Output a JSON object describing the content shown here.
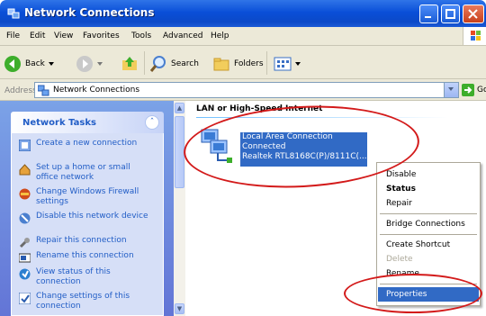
{
  "window": {
    "title": "Network Connections"
  },
  "menu": [
    "File",
    "Edit",
    "View",
    "Favorites",
    "Tools",
    "Advanced",
    "Help"
  ],
  "toolbar": {
    "back": "Back",
    "search": "Search",
    "folders": "Folders"
  },
  "address": {
    "label": "Address",
    "value": "Network Connections",
    "go": "Go"
  },
  "sidebar": {
    "title": "Network Tasks",
    "tasks": [
      "Create a new connection",
      "Set up a home or small office network",
      "Change Windows Firewall settings",
      "Disable this network device",
      "Repair this connection",
      "Rename this connection",
      "View status of this connection",
      "Change settings of this connection"
    ]
  },
  "content": {
    "group_title": "LAN or High-Speed Internet",
    "connection": {
      "name": "Local Area Connection",
      "status": "Connected",
      "device": "Realtek RTL8168C(P)/8111C(..."
    }
  },
  "context_menu": {
    "items": [
      "Disable",
      "Status",
      "Repair",
      "Bridge Connections",
      "Create Shortcut",
      "Delete",
      "Rename",
      "Properties"
    ]
  },
  "colors": {
    "title_blue": "#0a4fd8",
    "selection": "#316ac5",
    "annotation_red": "#d31a1a"
  }
}
